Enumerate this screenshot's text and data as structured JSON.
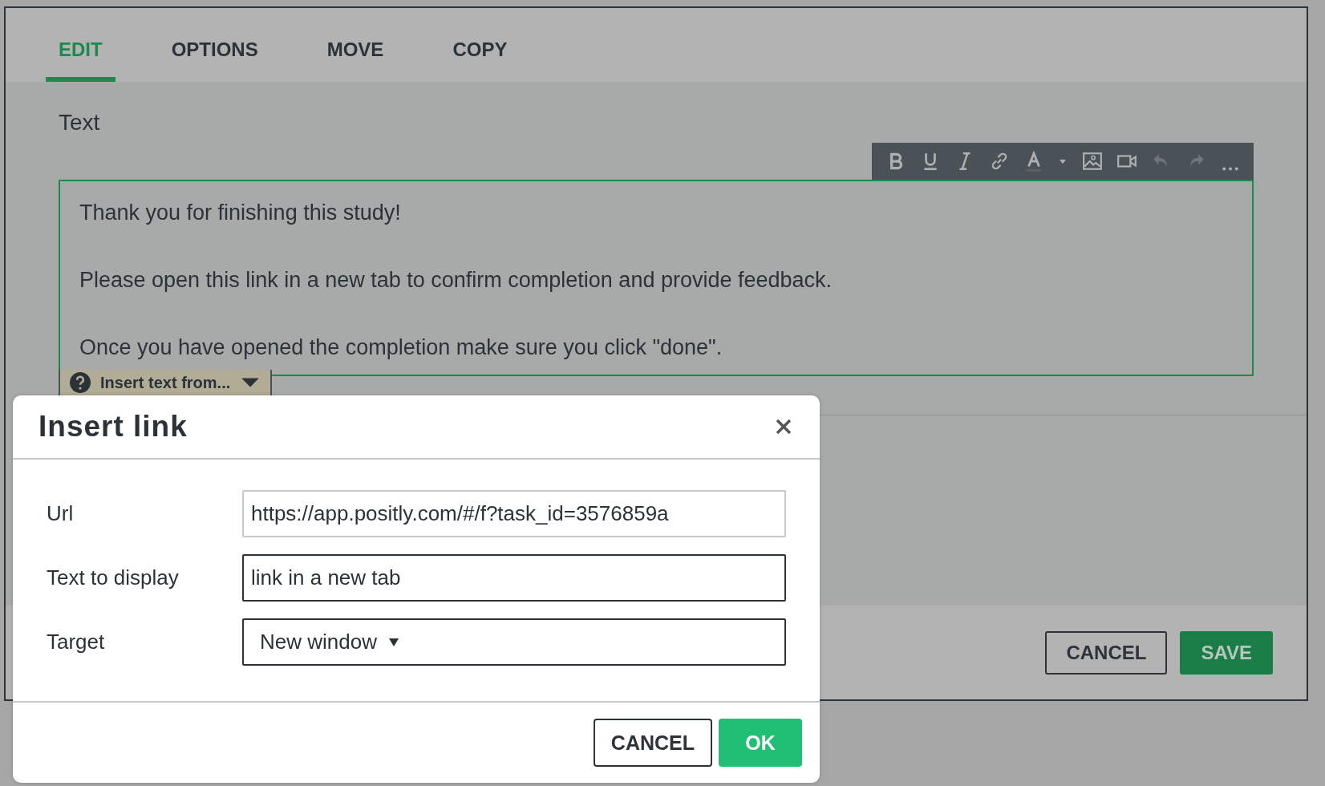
{
  "tabs": [
    {
      "label": "EDIT",
      "selected": true
    },
    {
      "label": "OPTIONS",
      "selected": false
    },
    {
      "label": "MOVE",
      "selected": false
    },
    {
      "label": "COPY",
      "selected": false
    }
  ],
  "field_label": "Text",
  "toolbar": [
    {
      "kind": "bold",
      "disabled": false
    },
    {
      "kind": "underline",
      "disabled": false
    },
    {
      "kind": "italic",
      "disabled": false
    },
    {
      "kind": "link",
      "disabled": false
    },
    {
      "kind": "text-color",
      "disabled": false
    },
    {
      "kind": "dropdown",
      "disabled": false
    },
    {
      "kind": "image",
      "disabled": false
    },
    {
      "kind": "video",
      "disabled": false
    },
    {
      "kind": "undo",
      "disabled": true
    },
    {
      "kind": "redo",
      "disabled": true
    },
    {
      "kind": "more",
      "disabled": false
    }
  ],
  "editor": {
    "paragraphs": [
      "Thank you for finishing this study!",
      "Please open this link in a new tab to confirm completion and provide feedback.",
      "Once you have opened the completion make sure you click \"done\"."
    ]
  },
  "insert_menu": {
    "label": "Insert text from..."
  },
  "panel_buttons": [
    {
      "label": "CANCEL",
      "kind": "secondary"
    },
    {
      "label": "SAVE",
      "kind": "primary"
    }
  ],
  "dialog": {
    "title": "Insert link",
    "fields": [
      {
        "label": "Url",
        "value": "https://app.positly.com/#/f?task_id=3576859a",
        "kind": "text",
        "emphasized": false
      },
      {
        "label": "Text to display",
        "value": "link in a new tab",
        "kind": "text",
        "emphasized": true
      },
      {
        "label": "Target",
        "value": "New window",
        "kind": "select",
        "emphasized": true
      }
    ],
    "buttons": [
      {
        "label": "CANCEL",
        "kind": "secondary"
      },
      {
        "label": "OK",
        "kind": "primary"
      }
    ]
  }
}
